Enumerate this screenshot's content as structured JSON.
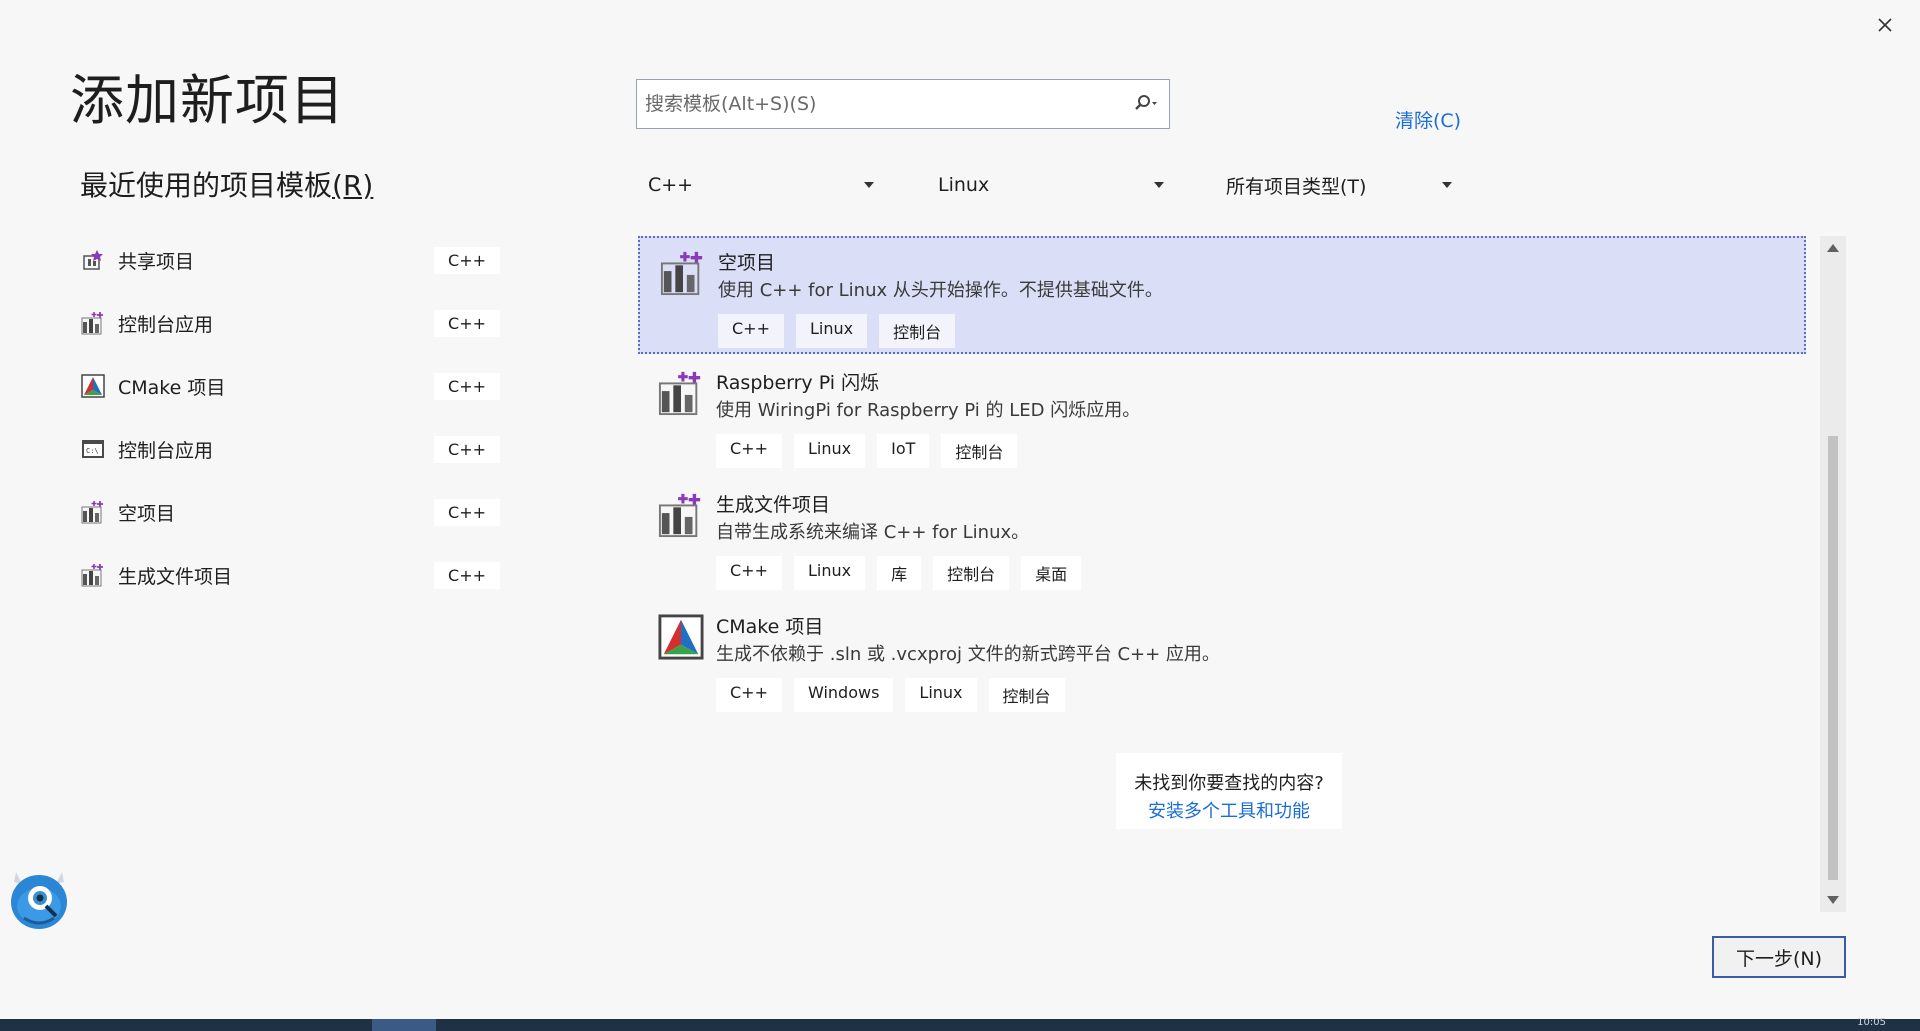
{
  "dialog": {
    "title": "添加新项目",
    "recent_title": "最近使用的项目模板",
    "recent_title_key": "(R)",
    "close_icon": "close-icon"
  },
  "recent": [
    {
      "label": "共享项目",
      "tag": "C++",
      "icon": "shared-project-icon"
    },
    {
      "label": "控制台应用",
      "tag": "C++",
      "icon": "linux-project-icon"
    },
    {
      "label": "CMake 项目",
      "tag": "C++",
      "icon": "cmake-icon"
    },
    {
      "label": "控制台应用",
      "tag": "C++",
      "icon": "console-app-icon"
    },
    {
      "label": "空项目",
      "tag": "C++",
      "icon": "linux-project-icon"
    },
    {
      "label": "生成文件项目",
      "tag": "C++",
      "icon": "linux-project-icon"
    }
  ],
  "search": {
    "placeholder": "搜索模板(Alt+S)(S)",
    "value": "",
    "clear_label": "清除(C)"
  },
  "filters": {
    "language": "C++",
    "platform": "Linux",
    "project_type": "所有项目类型(T)"
  },
  "templates": [
    {
      "name": "空项目",
      "desc": "使用 C++ for Linux 从头开始操作。不提供基础文件。",
      "tags": [
        "C++",
        "Linux",
        "控制台"
      ],
      "selected": true,
      "icon": "linux-project-icon"
    },
    {
      "name": "Raspberry Pi 闪烁",
      "desc": "使用 WiringPi for Raspberry Pi 的 LED 闪烁应用。",
      "tags": [
        "C++",
        "Linux",
        "IoT",
        "控制台"
      ],
      "selected": false,
      "icon": "linux-project-icon"
    },
    {
      "name": "生成文件项目",
      "desc": "自带生成系统来编译 C++ for Linux。",
      "tags": [
        "C++",
        "Linux",
        "库",
        "控制台",
        "桌面"
      ],
      "selected": false,
      "icon": "linux-project-icon"
    },
    {
      "name": "CMake 项目",
      "desc": "生成不依赖于 .sln 或 .vcxproj 文件的新式跨平台 C++ 应用。",
      "tags": [
        "C++",
        "Windows",
        "Linux",
        "控制台"
      ],
      "selected": false,
      "icon": "cmake-icon"
    }
  ],
  "not_found": {
    "text": "未找到你要查找的内容?",
    "link": "安装多个工具和功能"
  },
  "next_button": "下一步(N)",
  "taskbar": {
    "clock": "10:05"
  },
  "colors": {
    "accent": "#1a6dd6",
    "selected_bg": "#dadff7",
    "button_border": "#3c5aa6"
  }
}
